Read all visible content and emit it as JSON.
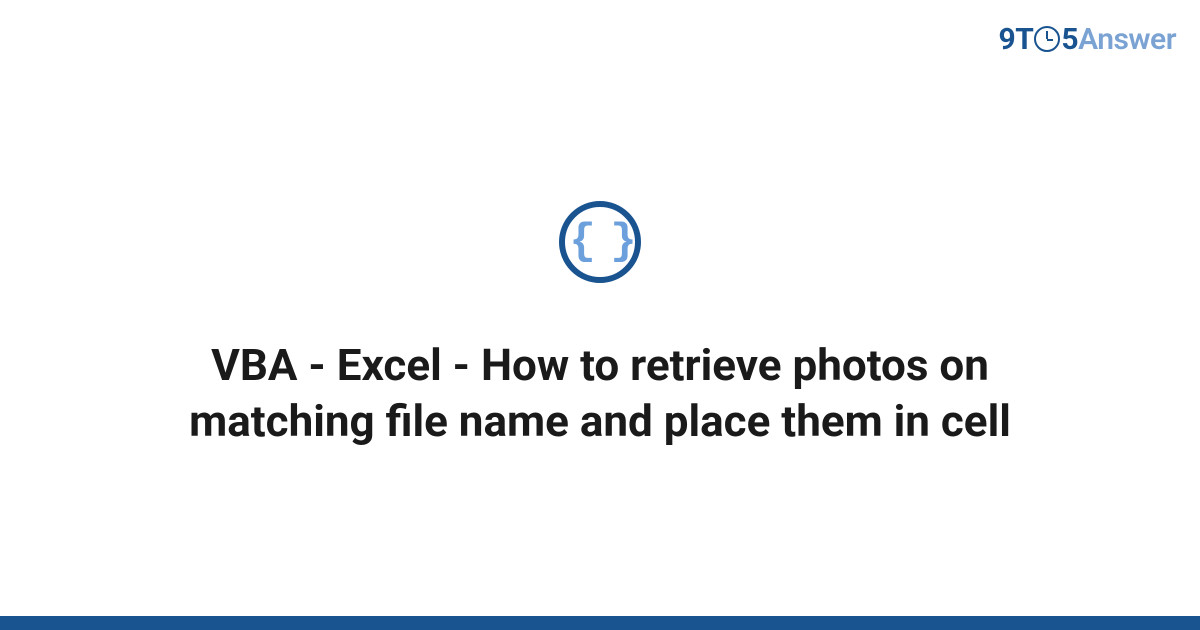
{
  "logo": {
    "part1": "9T",
    "part2": "5",
    "part3": "Answer"
  },
  "icon": {
    "braces": "{ }"
  },
  "title": "VBA - Excel - How to retrieve photos on matching file name and place them in cell",
  "colors": {
    "brand_dark": "#1a5490",
    "brand_light": "#7aa3d4",
    "brace_color": "#6ca0dc"
  }
}
